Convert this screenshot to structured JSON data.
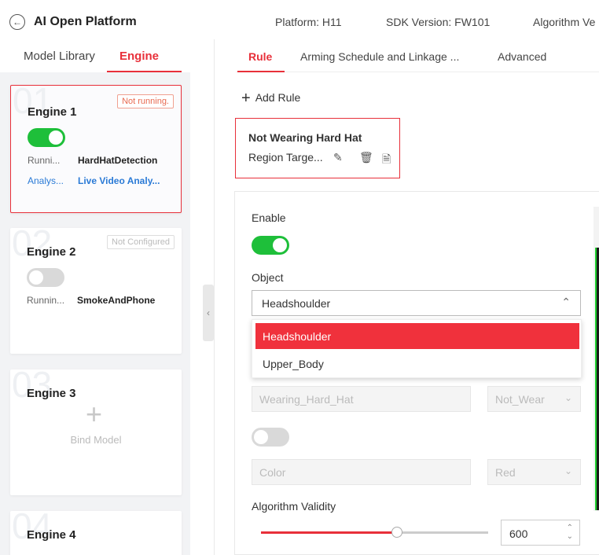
{
  "header": {
    "title": "AI Open Platform",
    "platform": "Platform: H11",
    "sdk": "SDK Version: FW101",
    "algorithm": "Algorithm Ve"
  },
  "left_tabs": [
    "Model Library",
    "Engine"
  ],
  "engines": [
    {
      "num": "01",
      "name": "Engine 1",
      "status": "Not running.",
      "enabled": true,
      "running_label": "Runni...",
      "model": "HardHatDetection",
      "analysis_label": "Analys...",
      "analysis_value": "Live Video Analy..."
    },
    {
      "num": "02",
      "name": "Engine 2",
      "status": "Not Configured",
      "enabled": false,
      "running_label": "Runnin...",
      "model": "SmokeAndPhone"
    },
    {
      "num": "03",
      "name": "Engine 3",
      "bind_label": "Bind Model"
    },
    {
      "num": "04",
      "name": "Engine 4"
    }
  ],
  "right_tabs": [
    "Rule",
    "Arming Schedule and Linkage ...",
    "Advanced"
  ],
  "add_rule": "Add Rule",
  "rule": {
    "title": "Not Wearing Hard Hat",
    "subtitle": "Region Targe..."
  },
  "form": {
    "enable_label": "Enable",
    "enabled": true,
    "object_label": "Object",
    "object_value": "Headshoulder",
    "object_options": [
      "Headshoulder",
      "Upper_Body"
    ],
    "attribute_value": "Wearing_Hard_Hat",
    "attribute_select": "Not_Wear",
    "color_value": "Color",
    "color_select": "Red",
    "validity_label": "Algorithm Validity",
    "validity_value": "600",
    "validity_fraction": 0.6
  },
  "colors": {
    "accent": "#e8303a",
    "toggle_on": "#1ebf3a",
    "link": "#2a7ad6"
  }
}
